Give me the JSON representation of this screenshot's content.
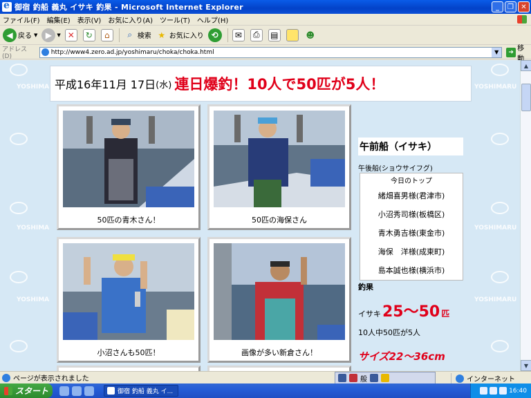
{
  "window": {
    "title": "御宿 釣船 義丸 イサキ 釣果 - Microsoft Internet Explorer",
    "buttons": {
      "minimize": "_",
      "maximize": "❐",
      "close": "✕"
    }
  },
  "menu": [
    "ファイル(F)",
    "編集(E)",
    "表示(V)",
    "お気に入り(A)",
    "ツール(T)",
    "ヘルプ(H)"
  ],
  "toolbar": {
    "back": "戻る",
    "search": "検索",
    "favorites": "お気に入り"
  },
  "address": {
    "label": "アドレス(D)",
    "url": "http://www4.zero.ad.jp/yoshimaru/choka/choka.html",
    "go": "移動"
  },
  "page": {
    "watermark": "YOSHIMARU",
    "headline": {
      "date": "平成16年11月 17日",
      "dow": "(水)",
      "catch": "連日爆釣！10人で50匹が5人！"
    },
    "photos": [
      {
        "caption": "50匹の青木さん！"
      },
      {
        "caption": "50匹の海保さん"
      },
      {
        "caption": "小沼さんも50匹！"
      },
      {
        "caption": "画像が多い新倉さん！"
      }
    ],
    "sidebar": {
      "title": "午前船（イサキ）",
      "afternoon_link": "午後船(ショウサイフグ)",
      "list": [
        "今日のトップ",
        "緒畑喜男様(君津市)",
        "小沼秀司様(板橋区)",
        "青木勇吉様(東金市)",
        "海保　洋様(成東町)",
        "島本誠也様(横浜市)"
      ],
      "result_label": "釣果",
      "species": "イサキ",
      "range": "25～50",
      "unit": "匹",
      "summary": "10人中50匹が5人",
      "size": "サイズ22～36cm"
    }
  },
  "status": {
    "text": "ページが表示されました",
    "zone": "インターネット",
    "ime": "般"
  },
  "taskbar": {
    "start": "スタート",
    "task": "御宿 釣船 義丸 イ...",
    "clock": "16:40"
  }
}
